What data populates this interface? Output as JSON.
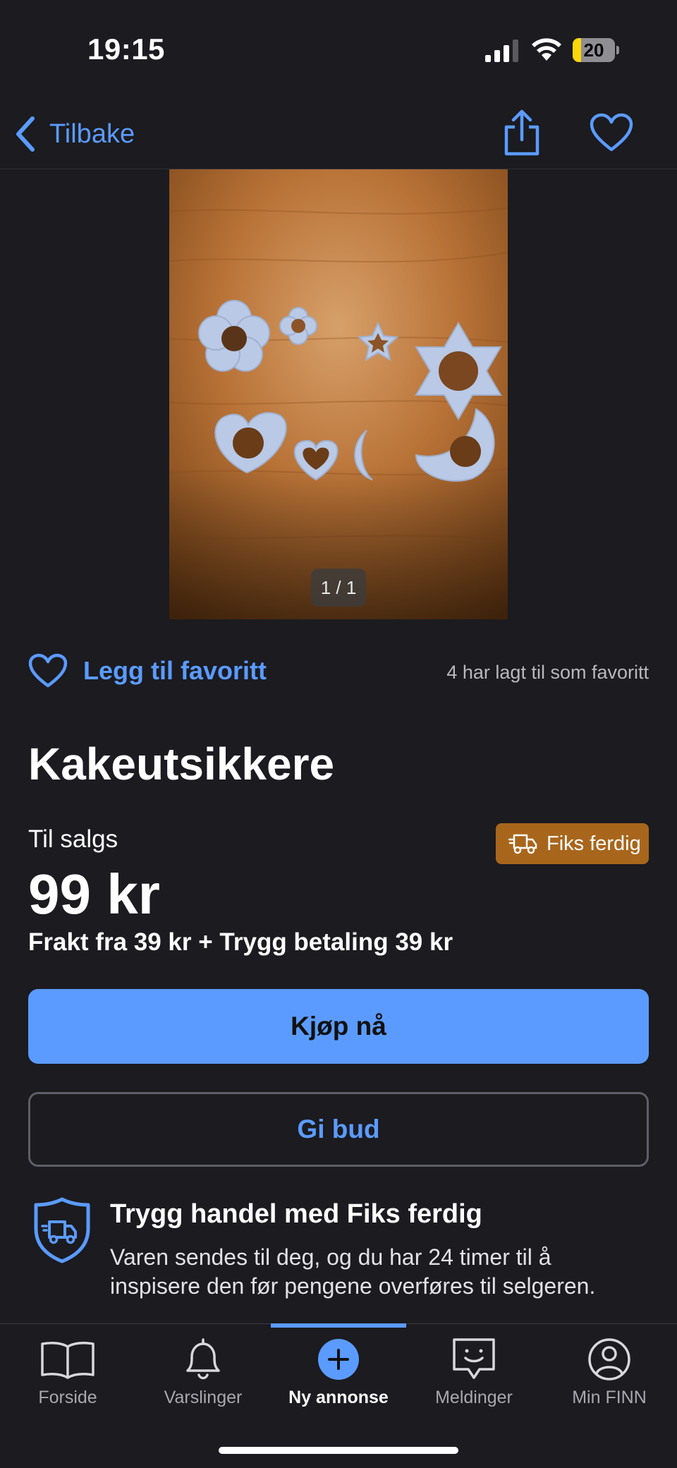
{
  "status_bar": {
    "time": "19:15",
    "battery": "20",
    "battery_level": 0.2
  },
  "nav": {
    "back_label": "Tilbake"
  },
  "gallery": {
    "counter": "1 / 1"
  },
  "favorite": {
    "label": "Legg til favoritt",
    "count_text": "4 har lagt til som favoritt"
  },
  "listing": {
    "title": "Kakeutsikkere",
    "sale_type": "Til salgs",
    "badge": "Fiks ferdig",
    "price": "99 kr",
    "shipping": "Frakt fra 39 kr + Trygg betaling 39 kr"
  },
  "actions": {
    "buy_label": "Kjøp nå",
    "bid_label": "Gi bud"
  },
  "trust": {
    "title": "Trygg handel med Fiks ferdig",
    "description": "Varen sendes til deg, og du har 24 timer til å inspisere den før pengene overføres til selgeren."
  },
  "tab_bar": {
    "items": [
      {
        "label": "Forside",
        "icon": "book-icon"
      },
      {
        "label": "Varslinger",
        "icon": "bell-icon"
      },
      {
        "label": "Ny annonse",
        "icon": "plus-circle-icon"
      },
      {
        "label": "Meldinger",
        "icon": "chat-icon"
      },
      {
        "label": "Min FINN",
        "icon": "profile-icon"
      }
    ],
    "active_index": 2
  },
  "colors": {
    "accent": "#5b9bff",
    "background": "#1b1b20",
    "badge": "#a8661c"
  }
}
